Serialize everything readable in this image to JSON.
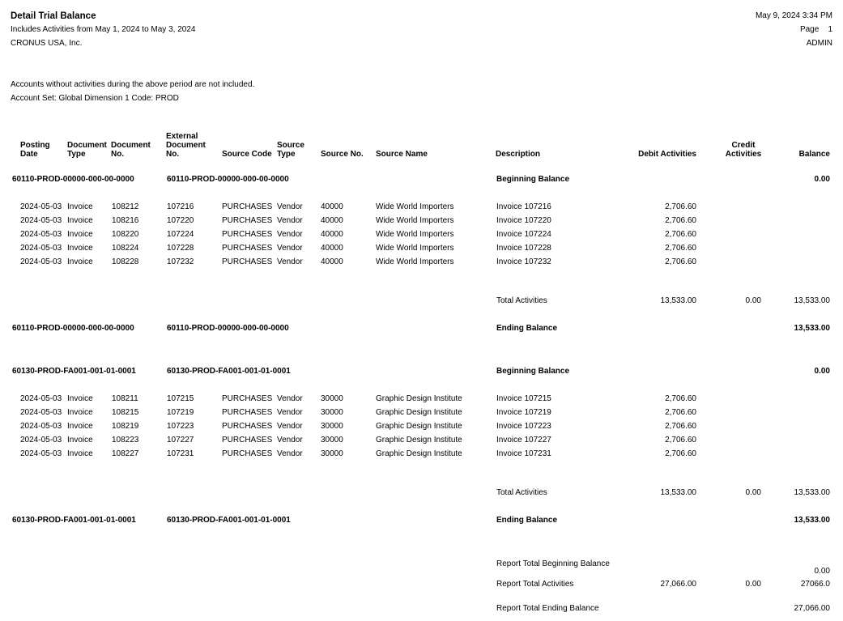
{
  "report": {
    "title": "Detail Trial Balance",
    "subtitle": "Includes Activities from May 1, 2024 to May 3, 2024",
    "company": "CRONUS USA, Inc.",
    "datetime": "May 9, 2024 3:34 PM",
    "page_label": "Page",
    "page_number": "1",
    "user": "ADMIN",
    "note": "Accounts without activities during the above period are not included.",
    "account_set": "Account Set: Global Dimension 1 Code: PROD"
  },
  "columns": {
    "posting_date": [
      "Posting",
      "Date"
    ],
    "document_type": [
      "Document",
      "Type"
    ],
    "document_no": [
      "Document",
      "No."
    ],
    "external_document_no": [
      "External",
      "Document",
      "No."
    ],
    "source_code": "Source Code",
    "source_type": [
      "Source",
      "Type"
    ],
    "source_no": "Source No.",
    "source_name": "Source Name",
    "description": "Description",
    "debit_activities": "Debit Activities",
    "credit_activities": [
      "Credit",
      "Activities"
    ],
    "balance": "Balance"
  },
  "accounts": [
    {
      "account": "60110-PROD-00000-000-00-0000",
      "account_name": "60110-PROD-00000-000-00-0000",
      "beginning_label": "Beginning Balance",
      "beginning_balance": "0.00",
      "entries": [
        {
          "date": "2024-05-03",
          "doc_type": "Invoice",
          "doc_no": "108212",
          "ext_doc_no": "107216",
          "source_code": "PURCHASES",
          "source_type": "Vendor",
          "source_no": "40000",
          "source_name": "Wide World Importers",
          "description": "Invoice 107216",
          "debit": "2,706.60"
        },
        {
          "date": "2024-05-03",
          "doc_type": "Invoice",
          "doc_no": "108216",
          "ext_doc_no": "107220",
          "source_code": "PURCHASES",
          "source_type": "Vendor",
          "source_no": "40000",
          "source_name": "Wide World Importers",
          "description": "Invoice 107220",
          "debit": "2,706.60"
        },
        {
          "date": "2024-05-03",
          "doc_type": "Invoice",
          "doc_no": "108220",
          "ext_doc_no": "107224",
          "source_code": "PURCHASES",
          "source_type": "Vendor",
          "source_no": "40000",
          "source_name": "Wide World Importers",
          "description": "Invoice 107224",
          "debit": "2,706.60"
        },
        {
          "date": "2024-05-03",
          "doc_type": "Invoice",
          "doc_no": "108224",
          "ext_doc_no": "107228",
          "source_code": "PURCHASES",
          "source_type": "Vendor",
          "source_no": "40000",
          "source_name": "Wide World Importers",
          "description": "Invoice 107228",
          "debit": "2,706.60"
        },
        {
          "date": "2024-05-03",
          "doc_type": "Invoice",
          "doc_no": "108228",
          "ext_doc_no": "107232",
          "source_code": "PURCHASES",
          "source_type": "Vendor",
          "source_no": "40000",
          "source_name": "Wide World Importers",
          "description": "Invoice 107232",
          "debit": "2,706.60"
        }
      ],
      "total_label": "Total Activities",
      "total_debit": "13,533.00",
      "total_credit": "0.00",
      "total_balance": "13,533.00",
      "ending_label": "Ending Balance",
      "ending_balance": "13,533.00"
    },
    {
      "account": "60130-PROD-FA001-001-01-0001",
      "account_name": "60130-PROD-FA001-001-01-0001",
      "beginning_label": "Beginning Balance",
      "beginning_balance": "0.00",
      "entries": [
        {
          "date": "2024-05-03",
          "doc_type": "Invoice",
          "doc_no": "108211",
          "ext_doc_no": "107215",
          "source_code": "PURCHASES",
          "source_type": "Vendor",
          "source_no": "30000",
          "source_name": "Graphic Design Institute",
          "description": "Invoice 107215",
          "debit": "2,706.60"
        },
        {
          "date": "2024-05-03",
          "doc_type": "Invoice",
          "doc_no": "108215",
          "ext_doc_no": "107219",
          "source_code": "PURCHASES",
          "source_type": "Vendor",
          "source_no": "30000",
          "source_name": "Graphic Design Institute",
          "description": "Invoice 107219",
          "debit": "2,706.60"
        },
        {
          "date": "2024-05-03",
          "doc_type": "Invoice",
          "doc_no": "108219",
          "ext_doc_no": "107223",
          "source_code": "PURCHASES",
          "source_type": "Vendor",
          "source_no": "30000",
          "source_name": "Graphic Design Institute",
          "description": "Invoice 107223",
          "debit": "2,706.60"
        },
        {
          "date": "2024-05-03",
          "doc_type": "Invoice",
          "doc_no": "108223",
          "ext_doc_no": "107227",
          "source_code": "PURCHASES",
          "source_type": "Vendor",
          "source_no": "30000",
          "source_name": "Graphic Design Institute",
          "description": "Invoice 107227",
          "debit": "2,706.60"
        },
        {
          "date": "2024-05-03",
          "doc_type": "Invoice",
          "doc_no": "108227",
          "ext_doc_no": "107231",
          "source_code": "PURCHASES",
          "source_type": "Vendor",
          "source_no": "30000",
          "source_name": "Graphic Design Institute",
          "description": "Invoice 107231",
          "debit": "2,706.60"
        }
      ],
      "total_label": "Total Activities",
      "total_debit": "13,533.00",
      "total_credit": "0.00",
      "total_balance": "13,533.00",
      "ending_label": "Ending Balance",
      "ending_balance": "13,533.00"
    }
  ],
  "report_totals": {
    "beginning_label": "Report Total Beginning Balance",
    "beginning_balance": "0.00",
    "activities_label": "Report Total Activities",
    "activities_debit": "27,066.00",
    "activities_credit": "0.00",
    "activities_balance": "27066.0",
    "ending_label": "Report Total Ending Balance",
    "ending_balance": "27,066.00"
  }
}
